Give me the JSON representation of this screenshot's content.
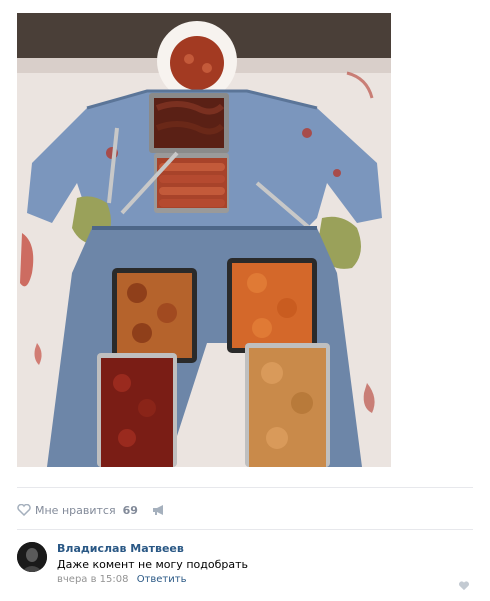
{
  "post": {
    "photo_icon": "photo-zombie-food-platter",
    "likes_label": "Мне нравится",
    "likes_count": "69",
    "like_icon": "heart-icon",
    "share_icon": "megaphone-icon"
  },
  "comment": {
    "author": "Владислав Матвеев",
    "text": "Даже комент не могу подобрать",
    "time": "вчера в 15:08",
    "reply_label": "Ответить",
    "avatar_icon": "avatar"
  },
  "colors": {
    "link": "#2a5885",
    "muted": "#828a99",
    "divider": "#e7e8ec"
  }
}
